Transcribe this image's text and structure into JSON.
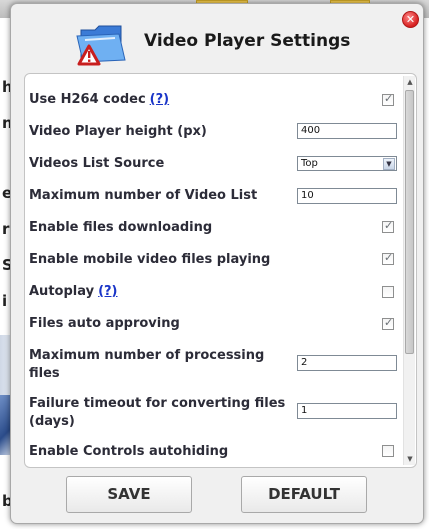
{
  "dialog": {
    "title": "Video Player Settings",
    "close_icon": "close-icon"
  },
  "settings": {
    "h264": {
      "label": "Use H264 codec",
      "help": "(?)",
      "checked": true
    },
    "player_height": {
      "label": "Video Player height (px)",
      "value": "400"
    },
    "videos_list_source": {
      "label": "Videos List Source",
      "selected": "Top"
    },
    "max_video_list": {
      "label": "Maximum number of Video List",
      "value": "10"
    },
    "files_downloading": {
      "label": "Enable files downloading",
      "checked": true
    },
    "mobile_playing": {
      "label": "Enable mobile video files playing",
      "checked": true
    },
    "autoplay": {
      "label": "Autoplay",
      "help": "(?)",
      "checked": false
    },
    "auto_approving": {
      "label": "Files auto approving",
      "checked": true
    },
    "max_processing": {
      "label_line1": "Maximum number of processing",
      "label_line2": "files",
      "value": "2"
    },
    "failure_timeout": {
      "label_line1": "Failure timeout for converting files",
      "label_line2": "(days)",
      "value": "1"
    },
    "controls_autohiding": {
      "label": "Enable Controls autohiding",
      "checked": false
    }
  },
  "buttons": {
    "save": "SAVE",
    "default": "DEFAULT"
  },
  "background": {
    "letters": [
      "h",
      "n",
      "e",
      "r",
      "S",
      "i",
      "b"
    ]
  },
  "colors": {
    "help_link": "#1a35c8",
    "close_button": "#d72020",
    "dialog_bg": "#f0f0f0"
  }
}
